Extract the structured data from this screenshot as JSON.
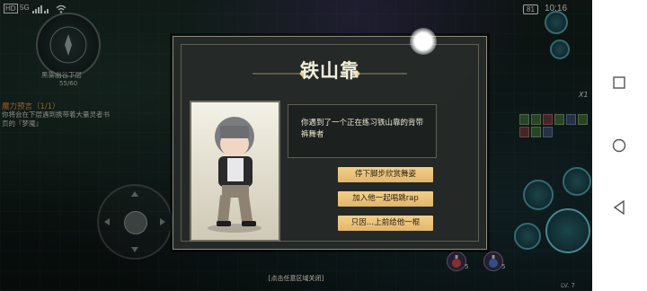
{
  "status_bar": {
    "left_icons": [
      "hd-icon",
      "5g-signal-icon",
      "signal-bars-icon",
      "wifi-icon"
    ],
    "hd_label": "HD",
    "network_label": "5G",
    "battery": "81",
    "time": "10:16"
  },
  "hud": {
    "location_name": "黑雾幽谷下层",
    "progress": "55/60",
    "quest": {
      "title": "魔力预言（1/1）",
      "description": "你将会在下层遇到携带着大量灵者书页的『梦魇』"
    },
    "multiplier_label": "X1",
    "potion_counts": [
      "5",
      "5"
    ],
    "level_label": "LV. 7"
  },
  "event_dialog": {
    "title": "铁山靠",
    "description": "你遇到了一个正在练习铁山靠的背带裤舞者",
    "choices": [
      "停下脚步欣赏舞姿",
      "加入他一起唱跳rap",
      "只因…上前给他一棍"
    ],
    "close_hint": "[点击任意区域关闭]"
  },
  "nav_bar": {
    "buttons": [
      "recents-square-icon",
      "home-circle-icon",
      "back-triangle-icon"
    ]
  },
  "colors": {
    "accent_gold": "#e3b569",
    "quest_orange": "#e59648",
    "dialog_bg": "#262a28"
  }
}
